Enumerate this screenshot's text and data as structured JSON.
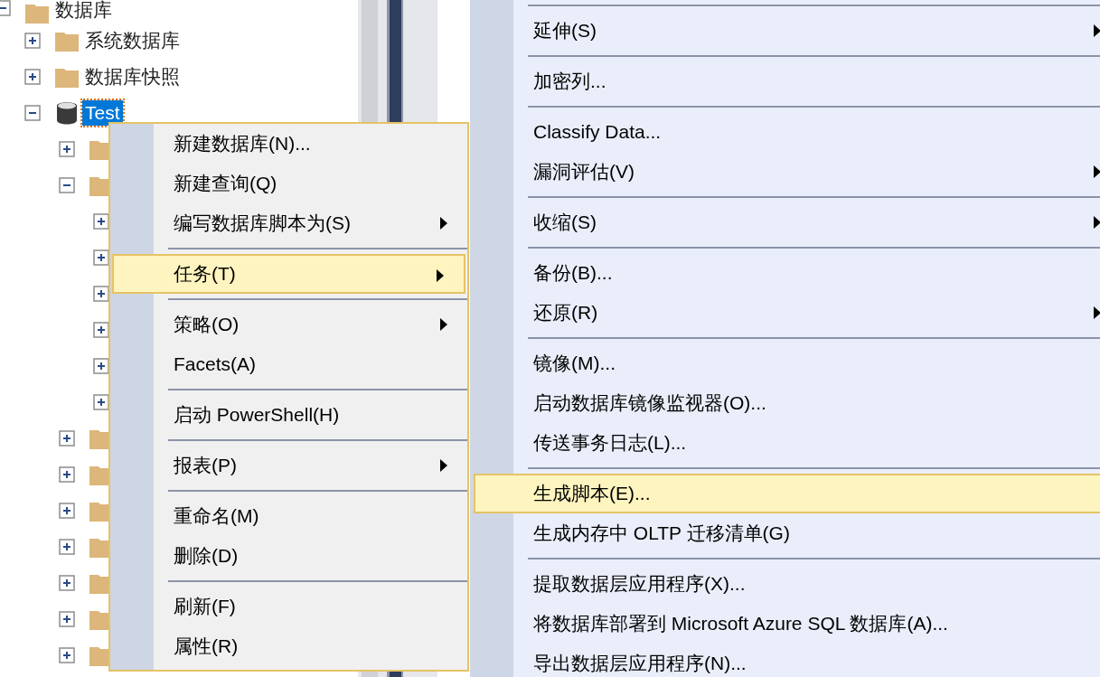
{
  "tree": [
    {
      "label": "数据库",
      "kind": "folder",
      "expanded": true,
      "selected": false,
      "children": [
        {
          "label": "系统数据库",
          "kind": "folder",
          "expanded": false,
          "selected": false
        },
        {
          "label": "数据库快照",
          "kind": "folder",
          "expanded": false,
          "selected": false
        },
        {
          "label": "Test",
          "kind": "database",
          "expanded": true,
          "selected": true,
          "children": [
            {
              "kind": "folder",
              "expanded": false,
              "selected": false
            },
            {
              "kind": "folder",
              "expanded": true,
              "selected": false,
              "children": [
                {
                  "expanded": false,
                  "selected": false
                },
                {
                  "expanded": false,
                  "selected": false
                },
                {
                  "expanded": false,
                  "selected": false
                },
                {
                  "expanded": false,
                  "selected": false
                },
                {
                  "expanded": false,
                  "selected": false
                },
                {
                  "expanded": false,
                  "selected": false
                }
              ]
            },
            {
              "kind": "folder",
              "expanded": false,
              "selected": false
            },
            {
              "kind": "folder",
              "expanded": false,
              "selected": false
            },
            {
              "kind": "folder",
              "expanded": false,
              "selected": false
            },
            {
              "kind": "folder",
              "expanded": false,
              "selected": false
            },
            {
              "kind": "folder",
              "expanded": false,
              "selected": false
            },
            {
              "kind": "folder",
              "expanded": false,
              "selected": false
            },
            {
              "kind": "folder",
              "expanded": false,
              "selected": false
            }
          ]
        }
      ]
    }
  ],
  "context_menu": [
    {
      "kind": "item",
      "label": "新建数据库(N)...",
      "submenu": false,
      "selected": false
    },
    {
      "kind": "item",
      "label": "新建查询(Q)",
      "submenu": false,
      "selected": false
    },
    {
      "kind": "item",
      "label": "编写数据库脚本为(S)",
      "submenu": true,
      "selected": false
    },
    {
      "kind": "separator"
    },
    {
      "kind": "item",
      "label": "任务(T)",
      "submenu": true,
      "selected": true
    },
    {
      "kind": "separator"
    },
    {
      "kind": "item",
      "label": "策略(O)",
      "submenu": true,
      "selected": false
    },
    {
      "kind": "item",
      "label": "Facets(A)",
      "submenu": false,
      "selected": false
    },
    {
      "kind": "separator"
    },
    {
      "kind": "item",
      "label": "启动 PowerShell(H)",
      "submenu": false,
      "selected": false
    },
    {
      "kind": "separator"
    },
    {
      "kind": "item",
      "label": "报表(P)",
      "submenu": true,
      "selected": false
    },
    {
      "kind": "separator"
    },
    {
      "kind": "item",
      "label": "重命名(M)",
      "submenu": false,
      "selected": false
    },
    {
      "kind": "item",
      "label": "删除(D)",
      "submenu": false,
      "selected": false
    },
    {
      "kind": "separator"
    },
    {
      "kind": "item",
      "label": "刷新(F)",
      "submenu": false,
      "selected": false
    },
    {
      "kind": "item",
      "label": "属性(R)",
      "submenu": false,
      "selected": false
    }
  ],
  "tasks_submenu": [
    {
      "kind": "separator"
    },
    {
      "kind": "item",
      "label": "延伸(S)",
      "submenu": true,
      "selected": false
    },
    {
      "kind": "separator"
    },
    {
      "kind": "item",
      "label": "加密列...",
      "submenu": false,
      "selected": false
    },
    {
      "kind": "separator"
    },
    {
      "kind": "item",
      "label": "Classify Data...",
      "submenu": false,
      "selected": false
    },
    {
      "kind": "item",
      "label": "漏洞评估(V)",
      "submenu": true,
      "selected": false
    },
    {
      "kind": "separator"
    },
    {
      "kind": "item",
      "label": "收缩(S)",
      "submenu": true,
      "selected": false
    },
    {
      "kind": "separator"
    },
    {
      "kind": "item",
      "label": "备份(B)...",
      "submenu": false,
      "selected": false
    },
    {
      "kind": "item",
      "label": "还原(R)",
      "submenu": true,
      "selected": false
    },
    {
      "kind": "separator"
    },
    {
      "kind": "item",
      "label": "镜像(M)...",
      "submenu": false,
      "selected": false
    },
    {
      "kind": "item",
      "label": "启动数据库镜像监视器(O)...",
      "submenu": false,
      "selected": false
    },
    {
      "kind": "item",
      "label": "传送事务日志(L)...",
      "submenu": false,
      "selected": false
    },
    {
      "kind": "separator"
    },
    {
      "kind": "item",
      "label": "生成脚本(E)...",
      "submenu": false,
      "selected": true
    },
    {
      "kind": "item",
      "label": "生成内存中 OLTP 迁移清单(G)",
      "submenu": false,
      "selected": false
    },
    {
      "kind": "separator"
    },
    {
      "kind": "item",
      "label": "提取数据层应用程序(X)...",
      "submenu": false,
      "selected": false
    },
    {
      "kind": "item",
      "label": "将数据库部署到 Microsoft Azure SQL 数据库(A)...",
      "submenu": false,
      "selected": false
    },
    {
      "kind": "item",
      "label": "导出数据层应用程序(N)...",
      "submenu": false,
      "selected": false
    }
  ]
}
